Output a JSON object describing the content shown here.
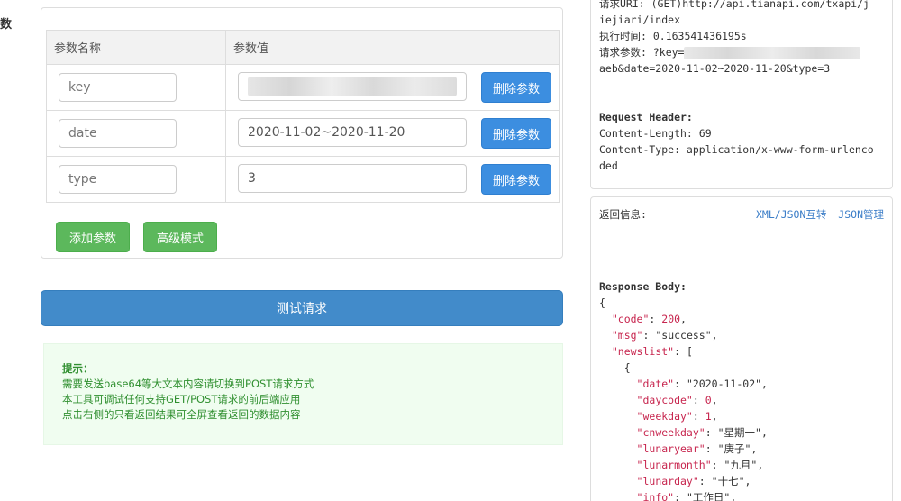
{
  "section_label": "数",
  "table": {
    "col_name_header": "参数名称",
    "col_value_header": "参数值",
    "rows": [
      {
        "name": "key",
        "value": ""
      },
      {
        "name": "date",
        "value": "2020-11-02~2020-11-20"
      },
      {
        "name": "type",
        "value": "3"
      }
    ],
    "delete_label": "删除参数"
  },
  "buttons": {
    "add": "添加参数",
    "advanced": "高级模式",
    "test": "测试请求"
  },
  "tips": {
    "title": "提示：",
    "lines": [
      "需要发送base64等大文本内容请切换到POST请求方式",
      "本工具可调试任何支持GET/POST请求的前后端应用",
      "点击右侧的只看返回结果可全屏查看返回的数据内容"
    ]
  },
  "request": {
    "uri_line1": "请求URI: (GET)http://api.tianapi.com/txapi/j",
    "uri_line2": "iejiari/index",
    "time_line": "执行时间: 0.163541436195s",
    "params_prefix": "请求参数: ?key=",
    "params_line2": "aeb&date=2020-11-02~2020-11-20&type=3",
    "header_title": "Request Header:",
    "header_line1": "Content-Length: 69",
    "header_line2": "Content-Type: application/x-www-form-urlenco",
    "header_line3": "ded"
  },
  "response": {
    "label": "返回信息:",
    "link_convert": "XML/JSON互转",
    "link_manage": "JSON管理",
    "body_title": "Response Body:",
    "code_key": "\"code\"",
    "code_val": "200",
    "msg_key": "\"msg\"",
    "msg_val": "\"success\"",
    "newslist_key": "\"newslist\"",
    "date_key": "\"date\"",
    "date_val": "\"2020-11-02\"",
    "daycode_key": "\"daycode\"",
    "daycode_val": "0",
    "weekday_key": "\"weekday\"",
    "weekday_val": "1",
    "cnweekday_key": "\"cnweekday\"",
    "cnweekday_val": "\"星期一\"",
    "lunaryear_key": "\"lunaryear\"",
    "lunaryear_val": "\"庚子\"",
    "lunarmonth_key": "\"lunarmonth\"",
    "lunarmonth_val": "\"九月\"",
    "lunarday_key": "\"lunarday\"",
    "lunarday_val": "\"十七\"",
    "info_key": "\"info\"",
    "info_val": "\"工作日\""
  },
  "colors": {
    "primary": "#428bca",
    "delete_button": "#3c8ee0",
    "success": "#5cb85c",
    "tips_text": "#2f8f2f",
    "json_key": "#c7254e"
  }
}
